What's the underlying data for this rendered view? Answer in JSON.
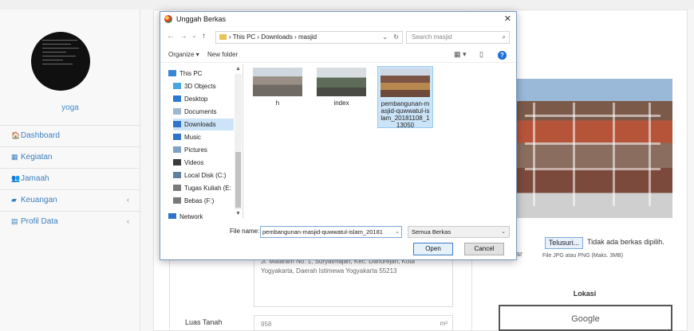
{
  "sidebar": {
    "username": "yoga",
    "items": [
      {
        "icon": "home-icon",
        "glyph": "🏠",
        "label": "Dashboard",
        "arrow": ""
      },
      {
        "icon": "calendar-icon",
        "glyph": "▦",
        "label": "Kegiatan",
        "arrow": ""
      },
      {
        "icon": "users-icon",
        "glyph": "👥",
        "label": "Jamaah",
        "arrow": ""
      },
      {
        "icon": "money-icon",
        "glyph": "▰",
        "label": "Keuangan",
        "arrow": "‹"
      },
      {
        "icon": "document-icon",
        "glyph": "▤",
        "label": "Profil Data",
        "arrow": "‹"
      }
    ]
  },
  "form": {
    "address_text": "Jl. Mataram No. 1, Suryatmajan, Kec. Danurejan, Kota Yogyakarta, Daerah Istimewa Yogyakarta 55213",
    "luas_label": "Luas Tanah",
    "luas_value": "958",
    "luas_unit": "m²",
    "upload_button": "Telusuri...",
    "upload_status": "Tidak ada berkas dipilih.",
    "upload_hint": "File JPG atau PNG (Maks. 3MB)",
    "lokasi_title": "Lokasi",
    "map_label": "Google"
  },
  "dialog": {
    "title": "Unggah Berkas",
    "close": "✕",
    "nav": {
      "back": "←",
      "forward": "→",
      "recent": "⌄",
      "up": "↑"
    },
    "breadcrumb": "›  This PC  ›  Downloads  ›  masjid",
    "breadcrumb_chevron": "⌄",
    "refresh": "↻",
    "search_placeholder": "Search masjid",
    "toolbar": {
      "organize": "Organize ▾",
      "new_folder": "New folder",
      "view": "▦ ▾",
      "pane": "▯",
      "help": "?"
    },
    "tree": [
      {
        "label": "This PC",
        "icon": "computer-icon",
        "color": "#3a86d1",
        "indent": 0,
        "selected": false
      },
      {
        "label": "3D Objects",
        "icon": "cube-icon",
        "color": "#49a6e0",
        "indent": 1,
        "selected": false
      },
      {
        "label": "Desktop",
        "icon": "desktop-icon",
        "color": "#2b7ad0",
        "indent": 1,
        "selected": false
      },
      {
        "label": "Documents",
        "icon": "documents-icon",
        "color": "#9fb7cf",
        "indent": 1,
        "selected": false
      },
      {
        "label": "Downloads",
        "icon": "download-icon",
        "color": "#2f74c9",
        "indent": 1,
        "selected": true
      },
      {
        "label": "Music",
        "icon": "music-icon",
        "color": "#2f74c9",
        "indent": 1,
        "selected": false
      },
      {
        "label": "Pictures",
        "icon": "pictures-icon",
        "color": "#7fa2c4",
        "indent": 1,
        "selected": false
      },
      {
        "label": "Videos",
        "icon": "videos-icon",
        "color": "#3b3b3b",
        "indent": 1,
        "selected": false
      },
      {
        "label": "Local Disk (C:)",
        "icon": "drive-icon",
        "color": "#5f7f9e",
        "indent": 1,
        "selected": false
      },
      {
        "label": "Tugas Kuliah (E:",
        "icon": "drive-icon",
        "color": "#7a7a7a",
        "indent": 1,
        "selected": false
      },
      {
        "label": "Bebas (F:)",
        "icon": "drive-icon",
        "color": "#7a7a7a",
        "indent": 1,
        "selected": false
      },
      {
        "label": "Network",
        "icon": "network-icon",
        "color": "#2f74c9",
        "indent": 0,
        "selected": false
      }
    ],
    "files": [
      {
        "name": "h",
        "selected": false
      },
      {
        "name": "index",
        "selected": false
      },
      {
        "name": "pembangunan-masjid-quwwatul-islam_20181108_113050",
        "selected": true
      }
    ],
    "filename_label": "File name:",
    "filename_value": "pembangunan-masjid-quwwatul-islam_20181",
    "filetype": "Semua Berkas",
    "open": "Open",
    "cancel": "Cancel"
  },
  "colors": {
    "link": "#3a7fbd",
    "selection": "#cde3f7"
  }
}
